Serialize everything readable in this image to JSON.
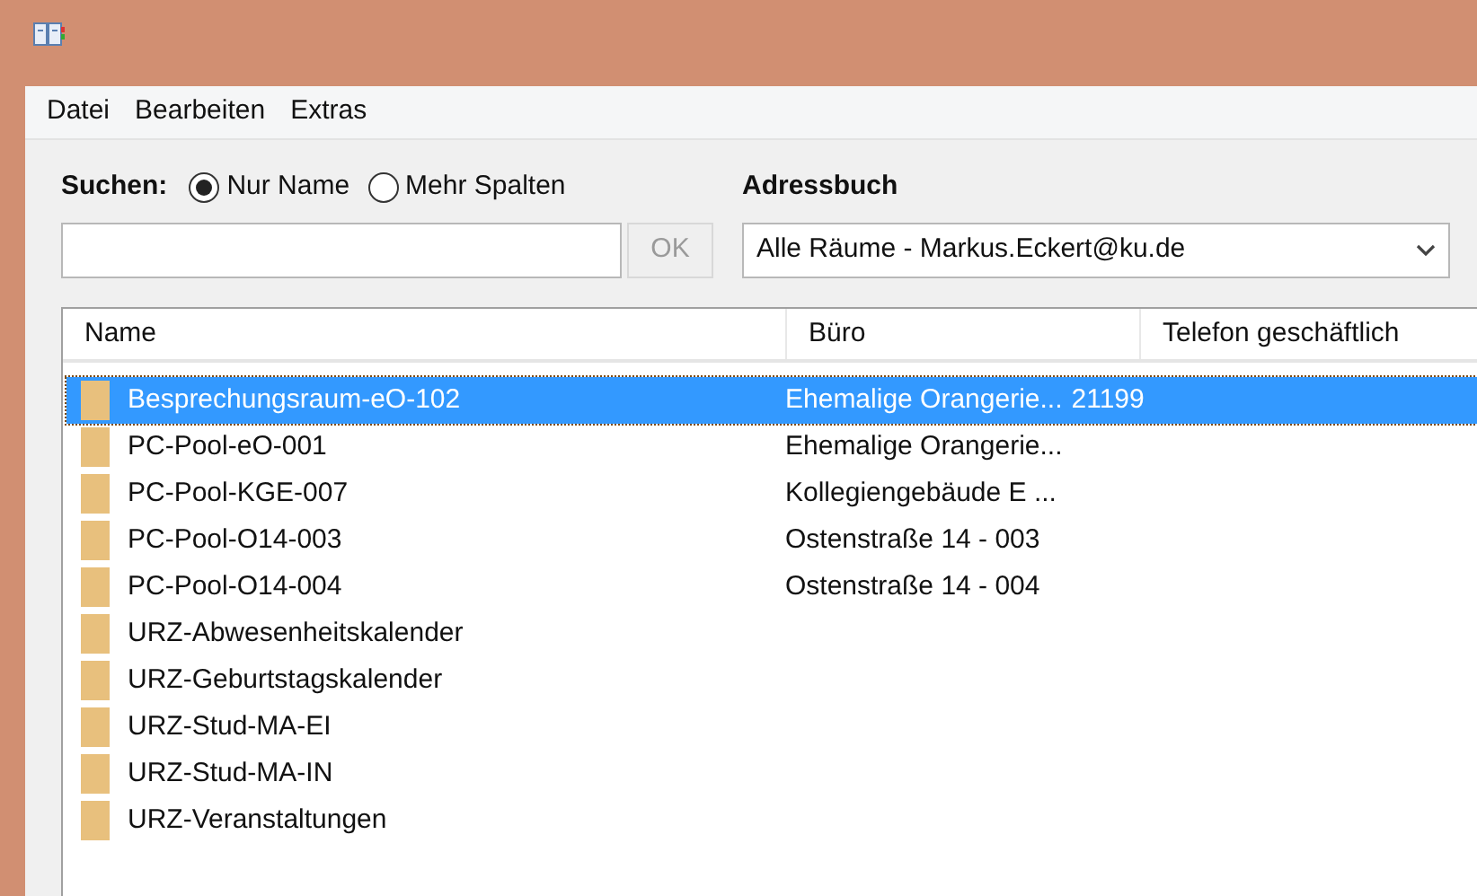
{
  "menu": [
    "Datei",
    "Bearbeiten",
    "Extras"
  ],
  "search": {
    "label": "Suchen:",
    "options": [
      {
        "label": "Nur Name",
        "selected": true
      },
      {
        "label": "Mehr Spalten",
        "selected": false
      }
    ],
    "button": "OK",
    "button_disabled": true
  },
  "addressbook": {
    "label": "Adressbuch",
    "value": "Alle Räume - Markus.Eckert@ku.de"
  },
  "table": {
    "columns": [
      "Name",
      "Büro",
      "Telefon geschäftlich"
    ],
    "rows": [
      {
        "name": "Besprechungsraum-eO-102",
        "office": "Ehemalige Orangerie...",
        "phone": "21199",
        "selected": true
      },
      {
        "name": "PC-Pool-eO-001",
        "office": "Ehemalige Orangerie...",
        "selected": false
      },
      {
        "name": "PC-Pool-KGE-007",
        "office": "Kollegiengebäude E ...",
        "selected": false
      },
      {
        "name": "PC-Pool-O14-003",
        "office": "Ostenstraße 14 - 003",
        "selected": false
      },
      {
        "name": "PC-Pool-O14-004",
        "office": "Ostenstraße 14 - 004",
        "selected": false
      },
      {
        "name": "URZ-Abwesenheitskalender",
        "selected": false
      },
      {
        "name": "URZ-Geburtstagskalender",
        "selected": false
      },
      {
        "name": "URZ-Stud-MA-EI",
        "selected": false
      },
      {
        "name": "URZ-Stud-MA-IN",
        "selected": false
      },
      {
        "name": "URZ-Veranstaltungen",
        "selected": false
      }
    ]
  }
}
